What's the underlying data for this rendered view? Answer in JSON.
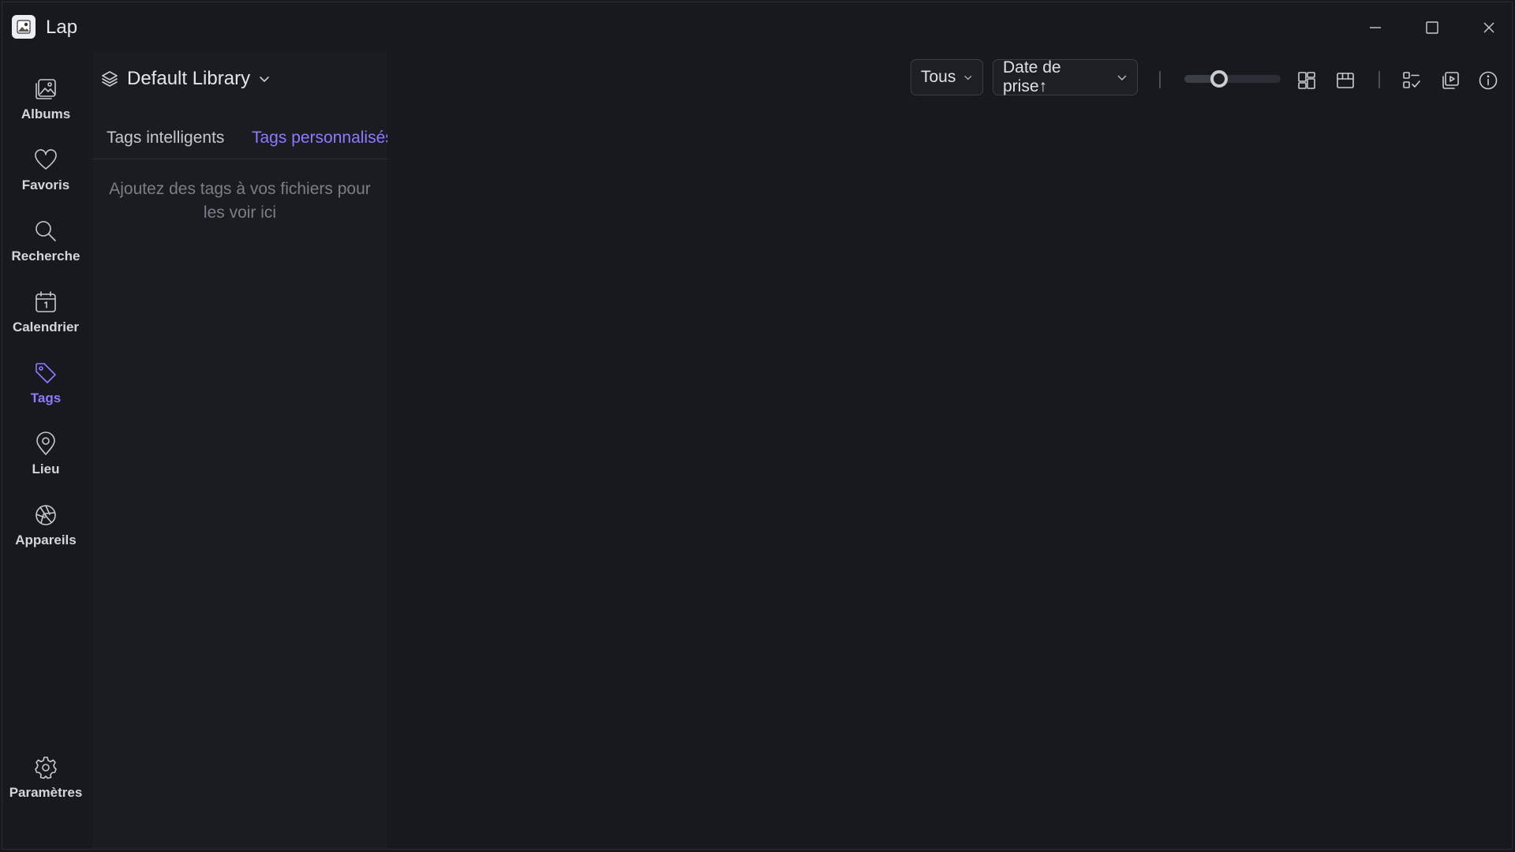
{
  "app": {
    "title": "Lap"
  },
  "sidebar": {
    "items": [
      {
        "label": "Albums",
        "icon": "albums-icon"
      },
      {
        "label": "Favoris",
        "icon": "heart-icon"
      },
      {
        "label": "Recherche",
        "icon": "search-icon"
      },
      {
        "label": "Calendrier",
        "icon": "calendar-icon"
      },
      {
        "label": "Tags",
        "icon": "tag-icon",
        "active": true
      },
      {
        "label": "Lieu",
        "icon": "location-pin-icon"
      },
      {
        "label": "Appareils",
        "icon": "camera-aperture-icon"
      }
    ],
    "settings": {
      "label": "Paramètres",
      "icon": "gear-icon"
    }
  },
  "panel": {
    "library_name": "Default Library",
    "tabs": [
      {
        "label": "Tags intelligents",
        "active": false
      },
      {
        "label": "Tags personnalisés",
        "active": true
      }
    ],
    "empty_message": "Ajoutez des tags à vos fichiers pour les voir ici"
  },
  "toolbar": {
    "filter_value": "Tous",
    "sort_value": "Date de prise↑",
    "thumbnail_size": 0.36
  },
  "colors": {
    "accent": "#8b7bff",
    "background": "#17191e",
    "panel": "#1a1c21"
  }
}
